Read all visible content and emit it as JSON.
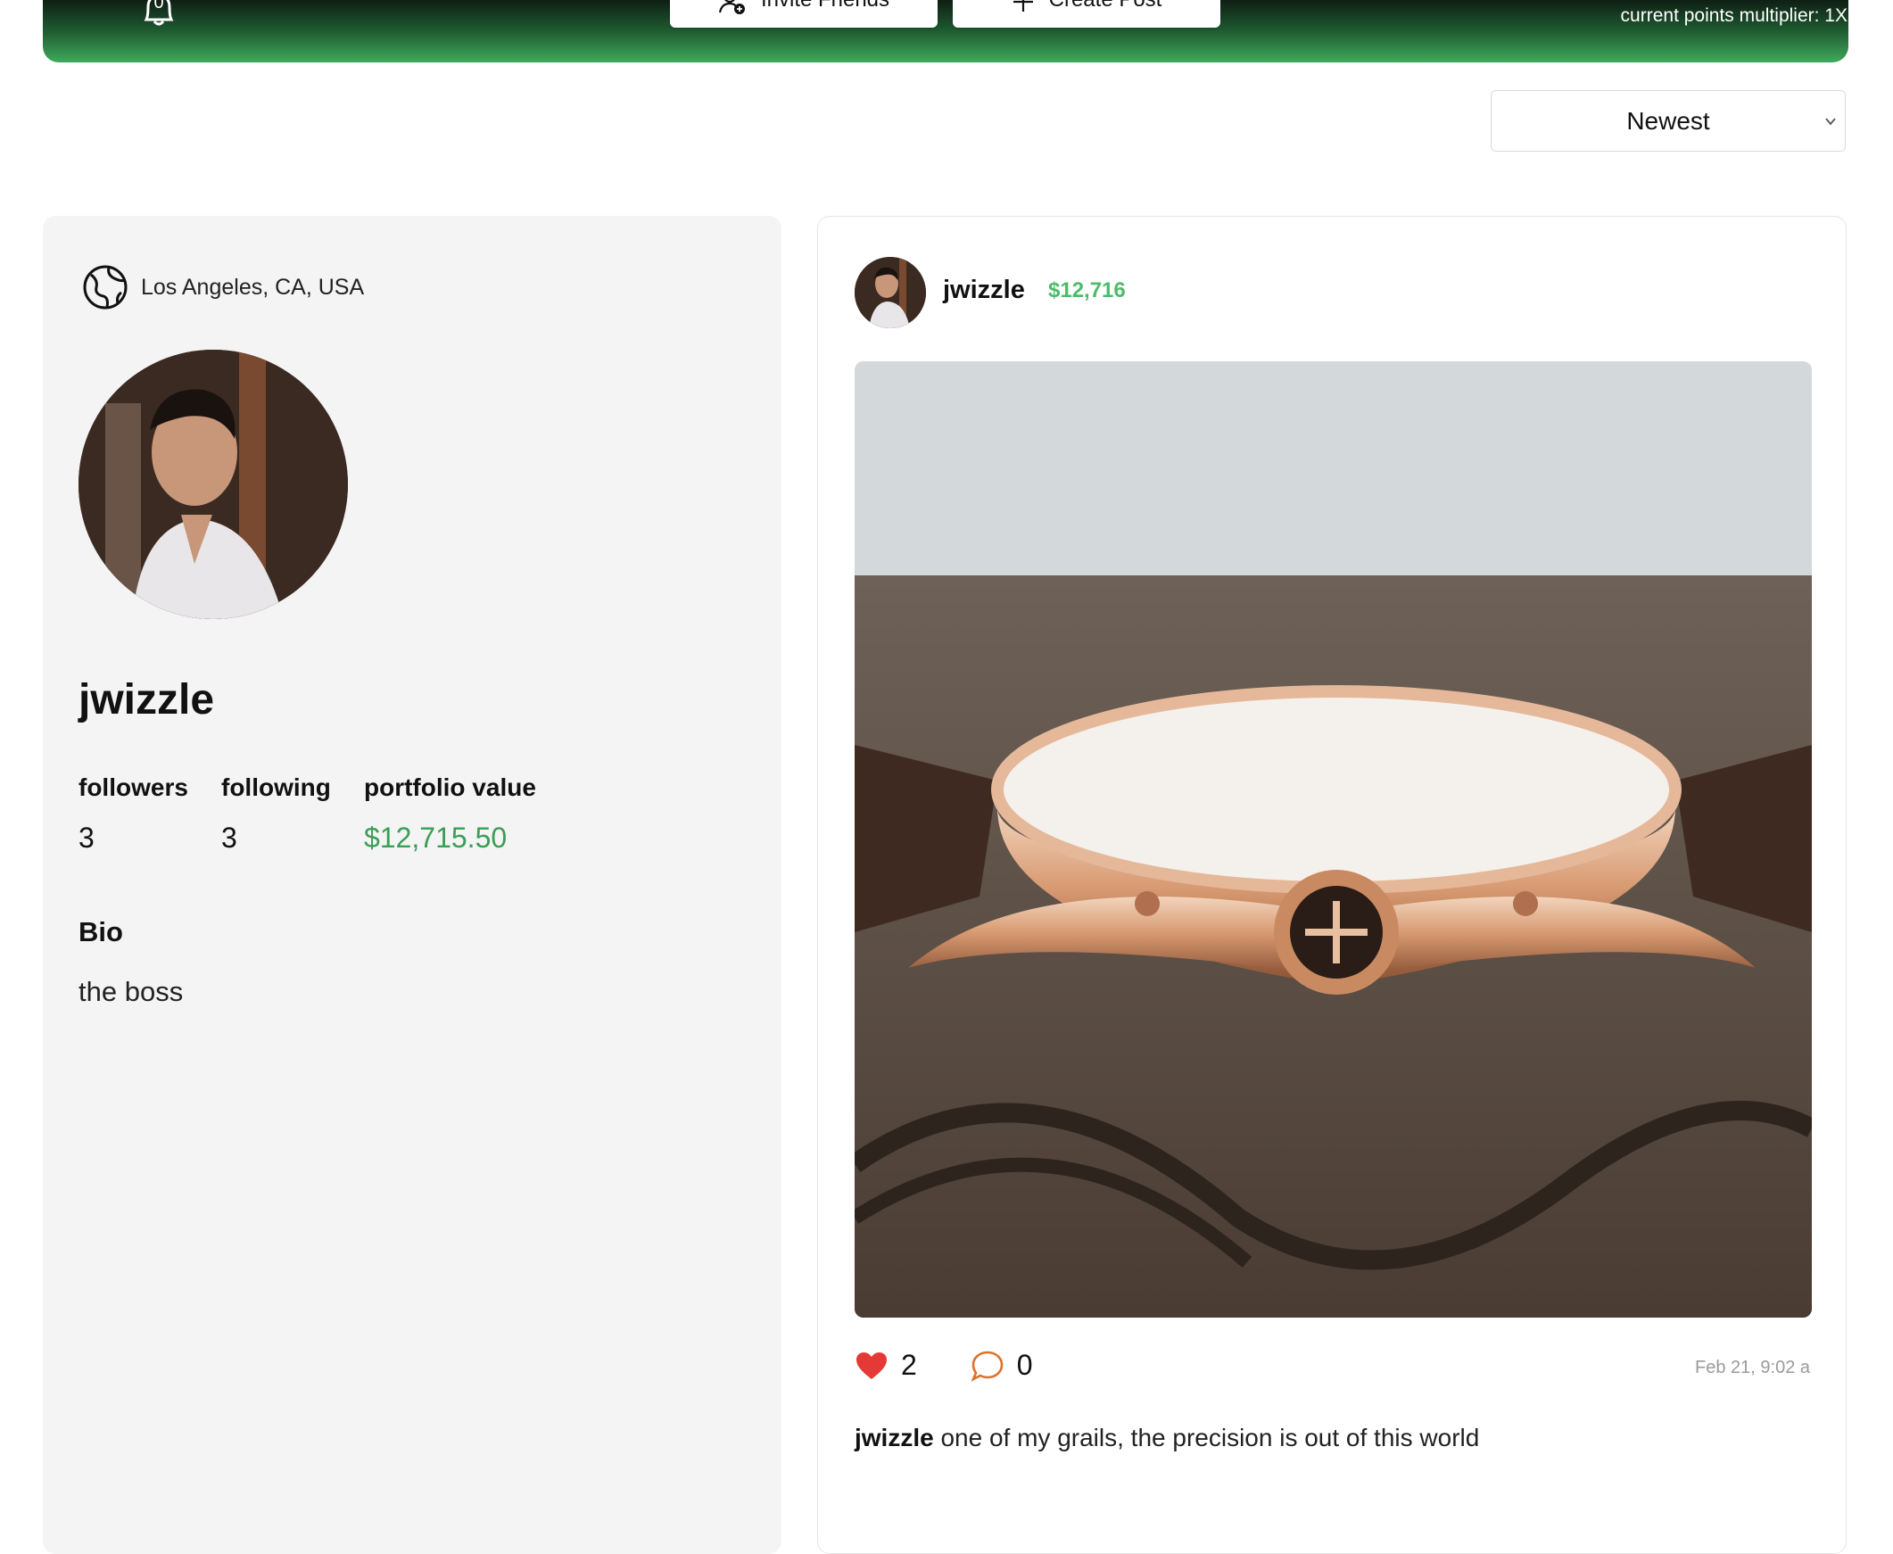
{
  "header": {
    "notification_count": "0",
    "invite_label": "Invite Friends",
    "create_label": "Create Post",
    "multiplier_text": "current points multiplier: 1X"
  },
  "sort": {
    "selected": "Newest"
  },
  "profile": {
    "location": "Los Angeles, CA, USA",
    "username": "jwizzle",
    "stats": [
      {
        "label": "followers",
        "value": "3"
      },
      {
        "label": "following",
        "value": "3"
      },
      {
        "label": "portfolio value",
        "value": "$12,715.50"
      }
    ],
    "bio_title": "Bio",
    "bio_text": "the boss"
  },
  "post": {
    "username": "jwizzle",
    "portfolio_value": "$12,716",
    "likes": "2",
    "comments": "0",
    "timestamp": "Feb 21, 9:02 a",
    "caption_user": "jwizzle",
    "caption_text": " one of my grails, the precision is out of this world"
  },
  "colors": {
    "accent_green": "#3a9e55",
    "heart_red": "#e53935",
    "comment_orange": "#e0702a"
  },
  "icons": [
    "bell-icon",
    "add-user-icon",
    "plus-icon",
    "chevron-down-icon",
    "globe-icon",
    "heart-icon",
    "comment-icon"
  ]
}
